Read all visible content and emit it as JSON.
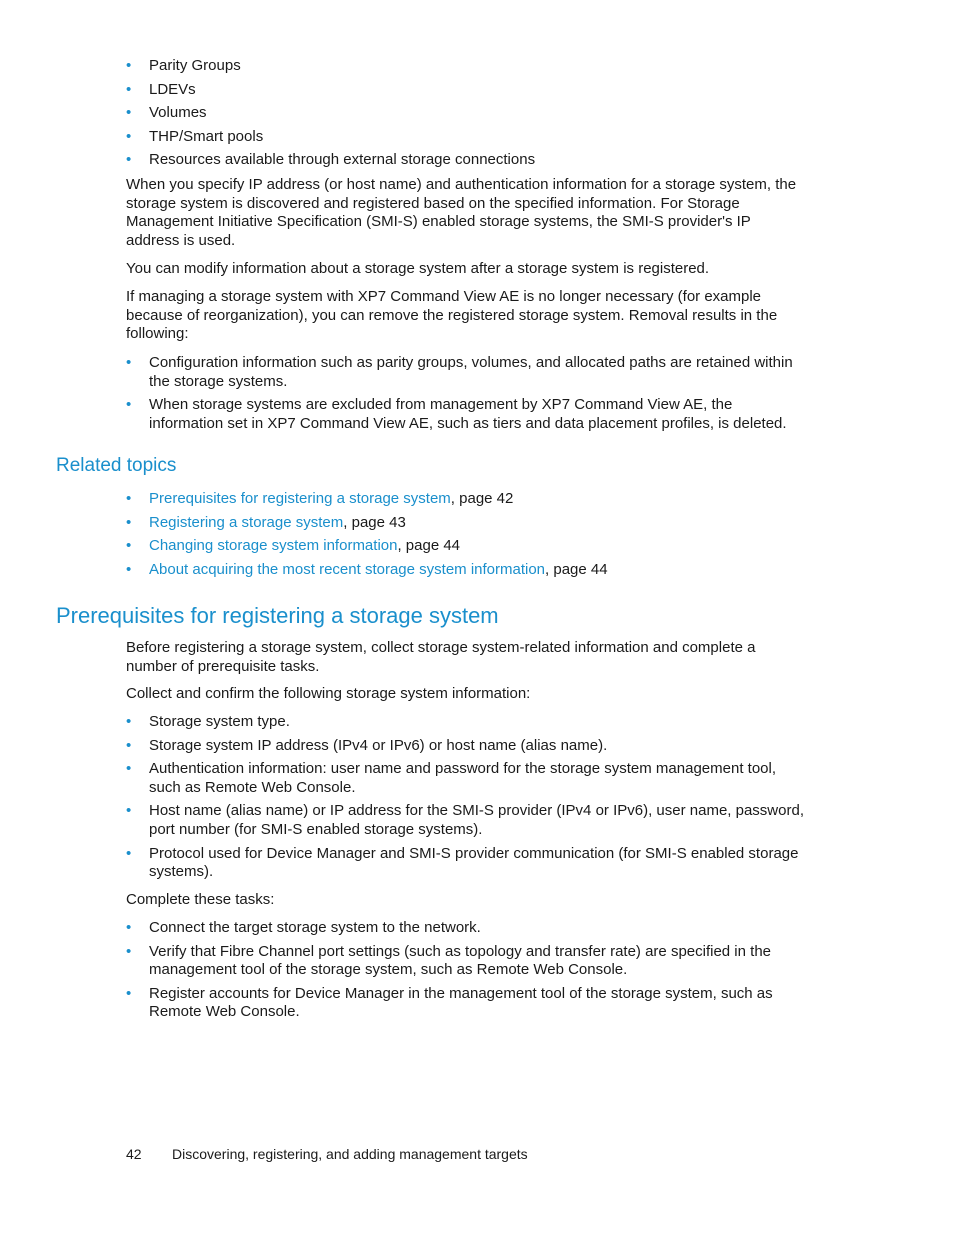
{
  "top_list": [
    "Parity Groups",
    "LDEVs",
    "Volumes",
    "THP/Smart pools",
    "Resources available through external storage connections"
  ],
  "paragraphs_1": [
    "When you specify IP address (or host name) and authentication information for a storage system, the storage system is discovered and registered based on the specified information. For Storage Management Initiative Specification (SMI-S) enabled storage systems, the SMI-S provider's IP address is used.",
    "You can modify information about a storage system after a storage system is registered.",
    "If managing a storage system with XP7 Command View AE is no longer necessary (for example because of reorganization), you can remove the registered storage system. Removal results in the following:"
  ],
  "removal_list": [
    "Configuration information such as parity groups, volumes, and allocated paths are retained within the storage systems.",
    "When storage systems are excluded from management by XP7 Command View AE, the information set in XP7 Command View AE, such as tiers and data placement profiles, is deleted."
  ],
  "related_topics": {
    "heading": "Related topics",
    "items": [
      {
        "link": "Prerequisites for registering a storage system",
        "suffix": ", page 42"
      },
      {
        "link": "Registering a storage system",
        "suffix": ", page 43"
      },
      {
        "link": "Changing storage system information",
        "suffix": ", page 44"
      },
      {
        "link": "About acquiring the most recent storage system information",
        "suffix": ", page 44"
      }
    ]
  },
  "prereq": {
    "heading": "Prerequisites for registering a storage system",
    "intro": "Before registering a storage system, collect storage system-related information and complete a number of prerequisite tasks.",
    "collect_label": "Collect and confirm the following storage system information:",
    "info_list": [
      "Storage system type.",
      "Storage system IP address (IPv4 or IPv6) or host name (alias name).",
      "Authentication information: user name and password for the storage system management tool, such as Remote Web Console.",
      "Host name (alias name) or IP address for the SMI-S provider (IPv4 or IPv6), user name, password, port number (for SMI-S enabled storage systems).",
      "Protocol used for Device Manager and SMI-S provider communication (for SMI-S enabled storage systems)."
    ],
    "tasks_label": "Complete these tasks:",
    "tasks_list": [
      "Connect the target storage system to the network.",
      "Verify that Fibre Channel port settings (such as topology and transfer rate) are specified in the management tool of the storage system, such as Remote Web Console.",
      "Register accounts for Device Manager in the management tool of the storage system, such as Remote Web Console."
    ]
  },
  "footer": {
    "page_number": "42",
    "chapter_title": "Discovering, registering, and adding management targets"
  }
}
